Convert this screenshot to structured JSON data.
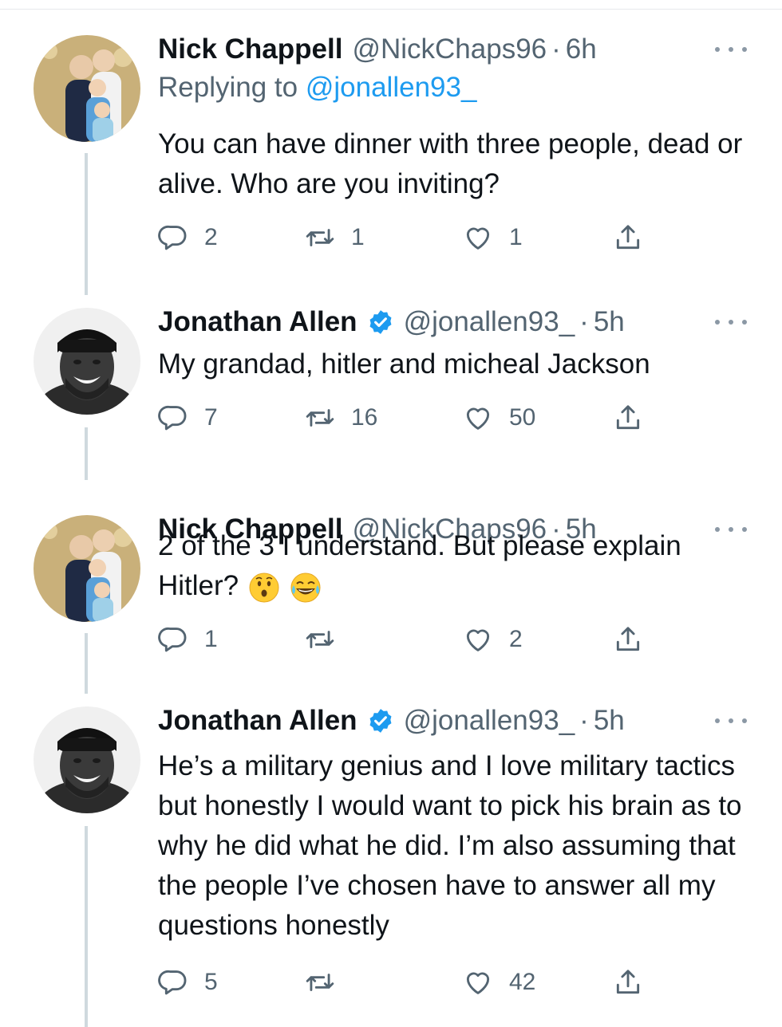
{
  "tweets": [
    {
      "name": "Nick Chappell",
      "handle": "@NickChaps96",
      "time": "6h",
      "replying_label": "Replying to",
      "replying_handle": "@jonallen93_",
      "text": "You can have dinner with three people, dead or alive. Who are you inviting?",
      "replies": "2",
      "retweets": "1",
      "likes": "1"
    },
    {
      "name": "Jonathan Allen",
      "handle": "@jonallen93_",
      "time": "5h",
      "verified": true,
      "text": "My grandad, hitler and micheal Jackson",
      "replies": "7",
      "retweets": "16",
      "likes": "50"
    },
    {
      "name": "Nick Chappell",
      "handle": "@NickChaps96",
      "time": "5h",
      "text": "2 of the 3 I understand. But please explain Hitler?",
      "emojis": [
        "hushed-face-emoji",
        "tears-of-joy-emoji"
      ],
      "replies": "1",
      "retweets": "",
      "likes": "2"
    },
    {
      "name": "Jonathan Allen",
      "handle": "@jonallen93_",
      "time": "5h",
      "verified": true,
      "text": "He’s a military genius and I love military tactics but honestly I would want to pick his brain as to why he did what he did. I’m also assuming that the people I’ve chosen have to answer all my questions honestly",
      "replies": "5",
      "retweets": "",
      "likes": "42"
    }
  ],
  "colors": {
    "link": "#1d9bf0",
    "secondary_text": "#536471",
    "primary_text": "#0f1419",
    "thread_line": "#cfd9de",
    "verified_badge": "#1d9bf0"
  },
  "icons": [
    "reply-icon",
    "retweet-icon",
    "like-icon",
    "share-icon",
    "more-icon",
    "verified-badge-icon"
  ]
}
